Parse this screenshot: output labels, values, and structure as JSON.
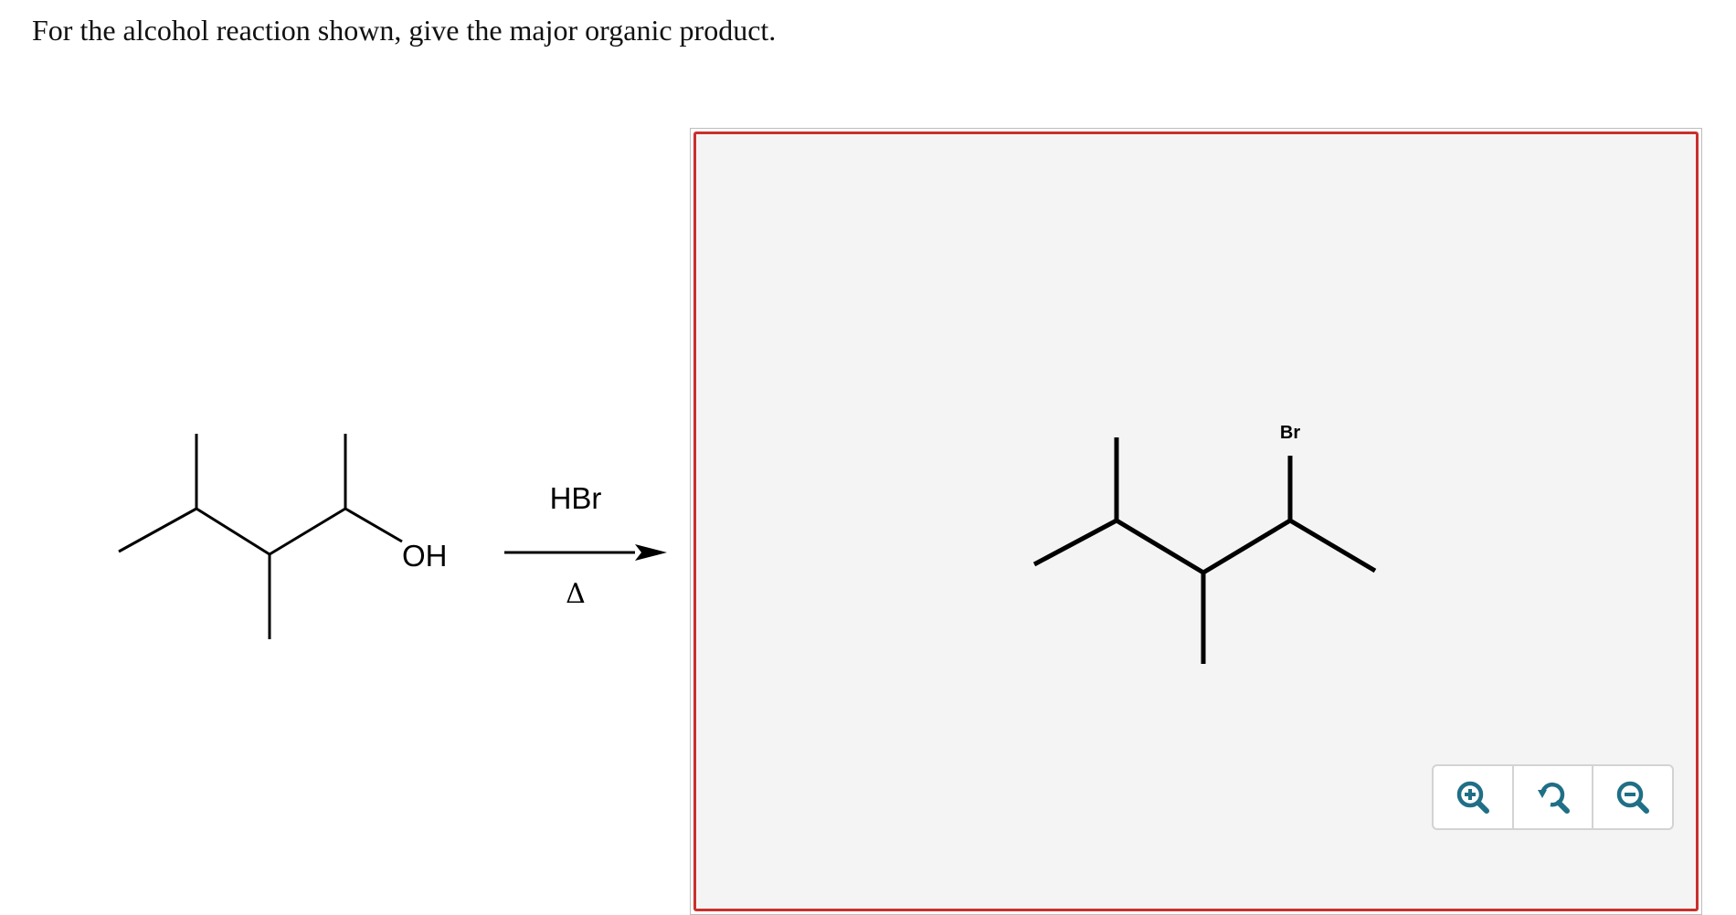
{
  "question": {
    "text": "For the alcohol reaction shown, give the major organic product."
  },
  "reactant": {
    "oh_label": "OH"
  },
  "reaction_arrow": {
    "reagent": "HBr",
    "condition": "Δ"
  },
  "answer_box": {
    "product_br_label": "Br",
    "border_color": "#c9302c",
    "background_color": "#f4f4f4"
  },
  "toolbar": {
    "icons": [
      "zoom-in-icon",
      "reset-zoom-icon",
      "zoom-out-icon"
    ],
    "icon_color": "#1f6f86"
  }
}
